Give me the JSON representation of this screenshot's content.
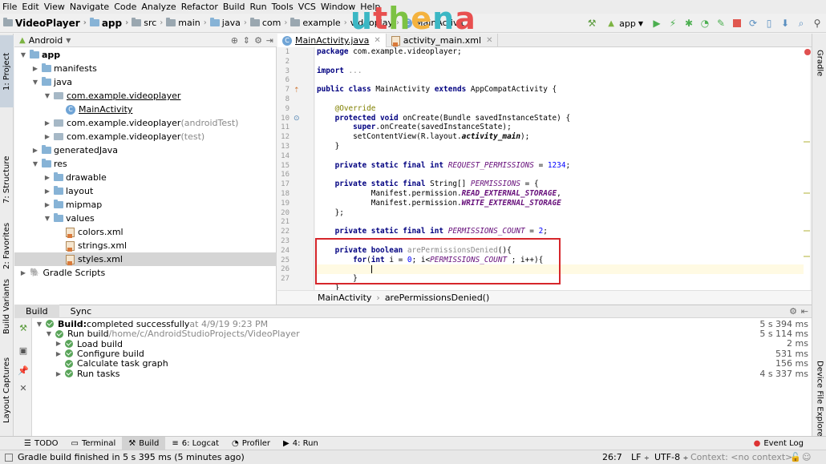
{
  "menu": [
    "File",
    "Edit",
    "View",
    "Navigate",
    "Code",
    "Analyze",
    "Refactor",
    "Build",
    "Run",
    "Tools",
    "VCS",
    "Window",
    "Help"
  ],
  "breadcrumb": [
    "VideoPlayer",
    "app",
    "src",
    "main",
    "java",
    "com",
    "example",
    "videoplay",
    "MainActivit"
  ],
  "watermark": {
    "letters": [
      "u",
      "t",
      "h",
      "e",
      "n",
      "a"
    ],
    "colors": [
      "#3bb7c4",
      "#e84f4f",
      "#7cc243",
      "#f4b23e",
      "#3bb7c4",
      "#e84f4f"
    ]
  },
  "run_config": "app",
  "left_tabs": [
    "1: Project",
    "7: Structure",
    "2: Favorites",
    "Build Variants",
    "Layout Captures"
  ],
  "right_tabs": [
    "Gradle",
    "Device File Explorer"
  ],
  "project": {
    "view_selector": "Android",
    "tree": [
      {
        "label": "app",
        "suffix": "",
        "bold": true,
        "level": 0,
        "expanded": true,
        "icon": "module"
      },
      {
        "label": "manifests",
        "suffix": "",
        "level": 1,
        "expanded": false,
        "icon": "folder"
      },
      {
        "label": "java",
        "suffix": "",
        "level": 1,
        "expanded": true,
        "icon": "folder"
      },
      {
        "label": "com.example.videoplayer",
        "suffix": "",
        "level": 2,
        "expanded": true,
        "icon": "package",
        "underline": true
      },
      {
        "label": "MainActivity",
        "suffix": "",
        "level": 3,
        "icon": "class",
        "underline": true
      },
      {
        "label": "com.example.videoplayer",
        "suffix": " (androidTest)",
        "level": 2,
        "expanded": false,
        "icon": "package"
      },
      {
        "label": "com.example.videoplayer",
        "suffix": " (test)",
        "level": 2,
        "expanded": false,
        "icon": "package"
      },
      {
        "label": "generatedJava",
        "suffix": "",
        "level": 1,
        "expanded": false,
        "icon": "folder"
      },
      {
        "label": "res",
        "suffix": "",
        "level": 1,
        "expanded": true,
        "icon": "folder"
      },
      {
        "label": "drawable",
        "suffix": "",
        "level": 2,
        "expanded": false,
        "icon": "folder"
      },
      {
        "label": "layout",
        "suffix": "",
        "level": 2,
        "expanded": false,
        "icon": "folder"
      },
      {
        "label": "mipmap",
        "suffix": "",
        "level": 2,
        "expanded": false,
        "icon": "folder"
      },
      {
        "label": "values",
        "suffix": "",
        "level": 2,
        "expanded": true,
        "icon": "folder"
      },
      {
        "label": "colors.xml",
        "suffix": "",
        "level": 3,
        "icon": "xml"
      },
      {
        "label": "strings.xml",
        "suffix": "",
        "level": 3,
        "icon": "xml"
      },
      {
        "label": "styles.xml",
        "suffix": "",
        "level": 3,
        "icon": "xml",
        "selected": true
      },
      {
        "label": "Gradle Scripts",
        "suffix": "",
        "level": 0,
        "expanded": false,
        "icon": "gradle"
      }
    ]
  },
  "editor": {
    "tabs": [
      {
        "label": "MainActivity.java",
        "active": true
      },
      {
        "label": "activity_main.xml",
        "active": false
      }
    ],
    "line_numbers": [
      "1",
      "2",
      "3",
      "6",
      "7",
      "8",
      "9",
      "10",
      "11",
      "12",
      "13",
      "14",
      "15",
      "16",
      "17",
      "18",
      "19",
      "20",
      "21",
      "22",
      "23",
      "24",
      "25",
      "26",
      "27"
    ],
    "breadcrumb": [
      "MainActivity",
      "arePermissionsDenied()"
    ]
  },
  "build": {
    "tabs": [
      "Build",
      "Sync"
    ],
    "rows": [
      {
        "label": "Build:",
        "detail": " completed successfully",
        "extra": " at 4/9/19 9:23 PM",
        "time": "5 s 394 ms",
        "level": 0,
        "bold": true
      },
      {
        "label": "Run build",
        "detail": "",
        "extra": " /home/c/AndroidStudioProjects/VideoPlayer",
        "time": "5 s 114 ms",
        "level": 1
      },
      {
        "label": "Load build",
        "detail": "",
        "extra": "",
        "time": "2 ms",
        "level": 2
      },
      {
        "label": "Configure build",
        "detail": "",
        "extra": "",
        "time": "531 ms",
        "level": 2
      },
      {
        "label": "Calculate task graph",
        "detail": "",
        "extra": "",
        "time": "156 ms",
        "level": 2
      },
      {
        "label": "Run tasks",
        "detail": "",
        "extra": "",
        "time": "4 s 337 ms",
        "level": 2
      }
    ]
  },
  "bottom_tools": [
    {
      "label": "TODO",
      "icon": "todo-icon"
    },
    {
      "label": "Terminal",
      "icon": "terminal-icon"
    },
    {
      "label": "Build",
      "icon": "build-hammer-icon",
      "active": true
    },
    {
      "label": "6: Logcat",
      "icon": "logcat-icon"
    },
    {
      "label": "Profiler",
      "icon": "profiler-icon"
    },
    {
      "label": "4: Run",
      "icon": "run-icon"
    }
  ],
  "event_log": "Event Log",
  "status": {
    "message": "Gradle build finished in 5 s 395 ms (5 minutes ago)",
    "position": "26:7",
    "line_sep": "LF",
    "encoding": "UTF-8",
    "context": "Context: <no context>"
  }
}
